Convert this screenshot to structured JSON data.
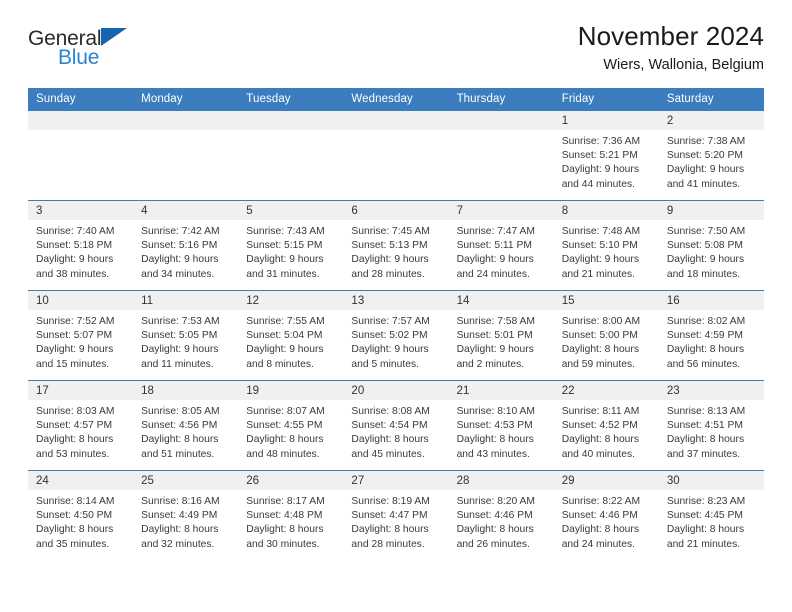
{
  "brand": {
    "name_part1": "General",
    "name_part2": "Blue",
    "flag_icon": "triangle-flag-icon",
    "accent_blue": "#2a85d0",
    "flag_blue": "#1565b0"
  },
  "header": {
    "title": "November 2024",
    "subtitle": "Wiers, Wallonia, Belgium"
  },
  "theme": {
    "header_row_blue": "#3C7DBF",
    "day_band_gray": "#F0F0F0",
    "text_dark": "#333333"
  },
  "weekday_headers": [
    "Sunday",
    "Monday",
    "Tuesday",
    "Wednesday",
    "Thursday",
    "Friday",
    "Saturday"
  ],
  "weeks": [
    [
      {
        "day": "",
        "sunrise": "",
        "sunset": "",
        "daylight_line1": "",
        "daylight_line2": ""
      },
      {
        "day": "",
        "sunrise": "",
        "sunset": "",
        "daylight_line1": "",
        "daylight_line2": ""
      },
      {
        "day": "",
        "sunrise": "",
        "sunset": "",
        "daylight_line1": "",
        "daylight_line2": ""
      },
      {
        "day": "",
        "sunrise": "",
        "sunset": "",
        "daylight_line1": "",
        "daylight_line2": ""
      },
      {
        "day": "",
        "sunrise": "",
        "sunset": "",
        "daylight_line1": "",
        "daylight_line2": ""
      },
      {
        "day": "1",
        "sunrise": "Sunrise: 7:36 AM",
        "sunset": "Sunset: 5:21 PM",
        "daylight_line1": "Daylight: 9 hours",
        "daylight_line2": "and 44 minutes."
      },
      {
        "day": "2",
        "sunrise": "Sunrise: 7:38 AM",
        "sunset": "Sunset: 5:20 PM",
        "daylight_line1": "Daylight: 9 hours",
        "daylight_line2": "and 41 minutes."
      }
    ],
    [
      {
        "day": "3",
        "sunrise": "Sunrise: 7:40 AM",
        "sunset": "Sunset: 5:18 PM",
        "daylight_line1": "Daylight: 9 hours",
        "daylight_line2": "and 38 minutes."
      },
      {
        "day": "4",
        "sunrise": "Sunrise: 7:42 AM",
        "sunset": "Sunset: 5:16 PM",
        "daylight_line1": "Daylight: 9 hours",
        "daylight_line2": "and 34 minutes."
      },
      {
        "day": "5",
        "sunrise": "Sunrise: 7:43 AM",
        "sunset": "Sunset: 5:15 PM",
        "daylight_line1": "Daylight: 9 hours",
        "daylight_line2": "and 31 minutes."
      },
      {
        "day": "6",
        "sunrise": "Sunrise: 7:45 AM",
        "sunset": "Sunset: 5:13 PM",
        "daylight_line1": "Daylight: 9 hours",
        "daylight_line2": "and 28 minutes."
      },
      {
        "day": "7",
        "sunrise": "Sunrise: 7:47 AM",
        "sunset": "Sunset: 5:11 PM",
        "daylight_line1": "Daylight: 9 hours",
        "daylight_line2": "and 24 minutes."
      },
      {
        "day": "8",
        "sunrise": "Sunrise: 7:48 AM",
        "sunset": "Sunset: 5:10 PM",
        "daylight_line1": "Daylight: 9 hours",
        "daylight_line2": "and 21 minutes."
      },
      {
        "day": "9",
        "sunrise": "Sunrise: 7:50 AM",
        "sunset": "Sunset: 5:08 PM",
        "daylight_line1": "Daylight: 9 hours",
        "daylight_line2": "and 18 minutes."
      }
    ],
    [
      {
        "day": "10",
        "sunrise": "Sunrise: 7:52 AM",
        "sunset": "Sunset: 5:07 PM",
        "daylight_line1": "Daylight: 9 hours",
        "daylight_line2": "and 15 minutes."
      },
      {
        "day": "11",
        "sunrise": "Sunrise: 7:53 AM",
        "sunset": "Sunset: 5:05 PM",
        "daylight_line1": "Daylight: 9 hours",
        "daylight_line2": "and 11 minutes."
      },
      {
        "day": "12",
        "sunrise": "Sunrise: 7:55 AM",
        "sunset": "Sunset: 5:04 PM",
        "daylight_line1": "Daylight: 9 hours",
        "daylight_line2": "and 8 minutes."
      },
      {
        "day": "13",
        "sunrise": "Sunrise: 7:57 AM",
        "sunset": "Sunset: 5:02 PM",
        "daylight_line1": "Daylight: 9 hours",
        "daylight_line2": "and 5 minutes."
      },
      {
        "day": "14",
        "sunrise": "Sunrise: 7:58 AM",
        "sunset": "Sunset: 5:01 PM",
        "daylight_line1": "Daylight: 9 hours",
        "daylight_line2": "and 2 minutes."
      },
      {
        "day": "15",
        "sunrise": "Sunrise: 8:00 AM",
        "sunset": "Sunset: 5:00 PM",
        "daylight_line1": "Daylight: 8 hours",
        "daylight_line2": "and 59 minutes."
      },
      {
        "day": "16",
        "sunrise": "Sunrise: 8:02 AM",
        "sunset": "Sunset: 4:59 PM",
        "daylight_line1": "Daylight: 8 hours",
        "daylight_line2": "and 56 minutes."
      }
    ],
    [
      {
        "day": "17",
        "sunrise": "Sunrise: 8:03 AM",
        "sunset": "Sunset: 4:57 PM",
        "daylight_line1": "Daylight: 8 hours",
        "daylight_line2": "and 53 minutes."
      },
      {
        "day": "18",
        "sunrise": "Sunrise: 8:05 AM",
        "sunset": "Sunset: 4:56 PM",
        "daylight_line1": "Daylight: 8 hours",
        "daylight_line2": "and 51 minutes."
      },
      {
        "day": "19",
        "sunrise": "Sunrise: 8:07 AM",
        "sunset": "Sunset: 4:55 PM",
        "daylight_line1": "Daylight: 8 hours",
        "daylight_line2": "and 48 minutes."
      },
      {
        "day": "20",
        "sunrise": "Sunrise: 8:08 AM",
        "sunset": "Sunset: 4:54 PM",
        "daylight_line1": "Daylight: 8 hours",
        "daylight_line2": "and 45 minutes."
      },
      {
        "day": "21",
        "sunrise": "Sunrise: 8:10 AM",
        "sunset": "Sunset: 4:53 PM",
        "daylight_line1": "Daylight: 8 hours",
        "daylight_line2": "and 43 minutes."
      },
      {
        "day": "22",
        "sunrise": "Sunrise: 8:11 AM",
        "sunset": "Sunset: 4:52 PM",
        "daylight_line1": "Daylight: 8 hours",
        "daylight_line2": "and 40 minutes."
      },
      {
        "day": "23",
        "sunrise": "Sunrise: 8:13 AM",
        "sunset": "Sunset: 4:51 PM",
        "daylight_line1": "Daylight: 8 hours",
        "daylight_line2": "and 37 minutes."
      }
    ],
    [
      {
        "day": "24",
        "sunrise": "Sunrise: 8:14 AM",
        "sunset": "Sunset: 4:50 PM",
        "daylight_line1": "Daylight: 8 hours",
        "daylight_line2": "and 35 minutes."
      },
      {
        "day": "25",
        "sunrise": "Sunrise: 8:16 AM",
        "sunset": "Sunset: 4:49 PM",
        "daylight_line1": "Daylight: 8 hours",
        "daylight_line2": "and 32 minutes."
      },
      {
        "day": "26",
        "sunrise": "Sunrise: 8:17 AM",
        "sunset": "Sunset: 4:48 PM",
        "daylight_line1": "Daylight: 8 hours",
        "daylight_line2": "and 30 minutes."
      },
      {
        "day": "27",
        "sunrise": "Sunrise: 8:19 AM",
        "sunset": "Sunset: 4:47 PM",
        "daylight_line1": "Daylight: 8 hours",
        "daylight_line2": "and 28 minutes."
      },
      {
        "day": "28",
        "sunrise": "Sunrise: 8:20 AM",
        "sunset": "Sunset: 4:46 PM",
        "daylight_line1": "Daylight: 8 hours",
        "daylight_line2": "and 26 minutes."
      },
      {
        "day": "29",
        "sunrise": "Sunrise: 8:22 AM",
        "sunset": "Sunset: 4:46 PM",
        "daylight_line1": "Daylight: 8 hours",
        "daylight_line2": "and 24 minutes."
      },
      {
        "day": "30",
        "sunrise": "Sunrise: 8:23 AM",
        "sunset": "Sunset: 4:45 PM",
        "daylight_line1": "Daylight: 8 hours",
        "daylight_line2": "and 21 minutes."
      }
    ]
  ]
}
